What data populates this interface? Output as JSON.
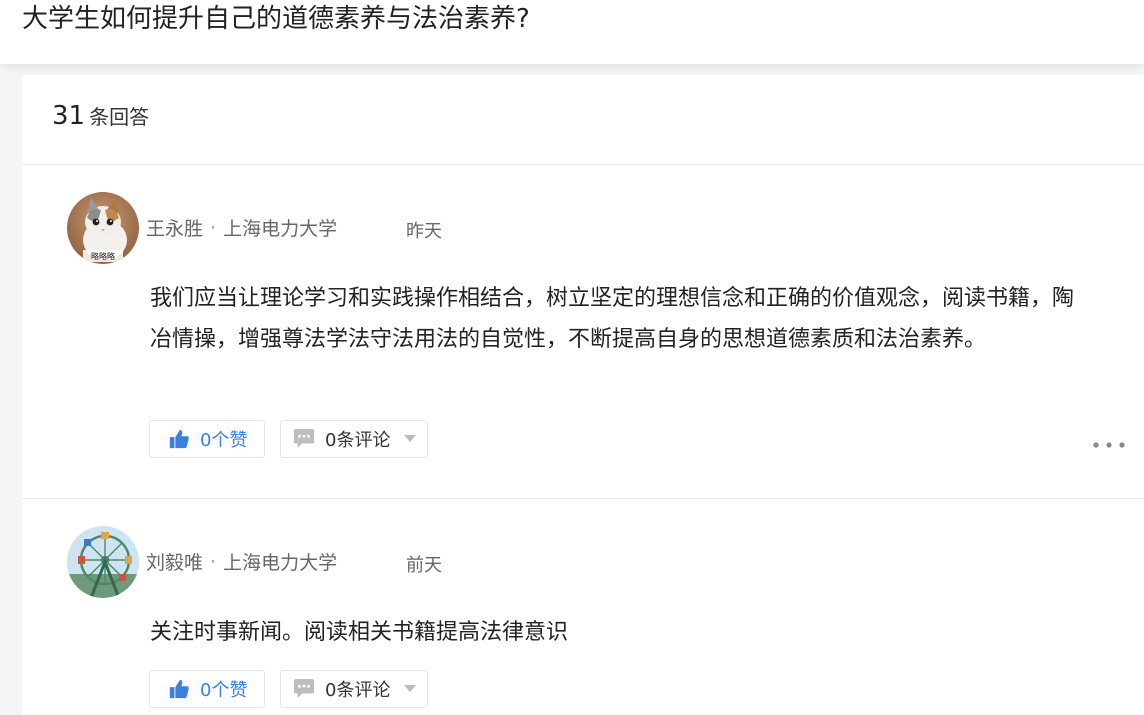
{
  "question": {
    "title": "大学生如何提升自己的道德素养与法治素养?"
  },
  "answers_header": {
    "count": "31",
    "label": "条回答"
  },
  "answers": [
    {
      "author": "王永胜",
      "separator": "·",
      "school": "上海电力大学",
      "time": "昨天",
      "avatar_caption": "略略略",
      "text": "我们应当让理论学习和实践操作相结合，树立坚定的理想信念和正确的价值观念，阅读书籍，陶冶情操，增强尊法学法守法用法的自觉性，不断提高自身的思想道德素质和法治素养。",
      "like_label": "0个赞",
      "comment_label": "0条评论"
    },
    {
      "author": "刘毅唯",
      "separator": "·",
      "school": "上海电力大学",
      "time": "前天",
      "text": "关注时事新闻。阅读相关书籍提高法律意识",
      "like_label": "0个赞",
      "comment_label": "0条评论"
    }
  ],
  "colors": {
    "accent": "#3b7fe0",
    "background": "#f4f5f7",
    "divider": "#e8e8e8"
  }
}
